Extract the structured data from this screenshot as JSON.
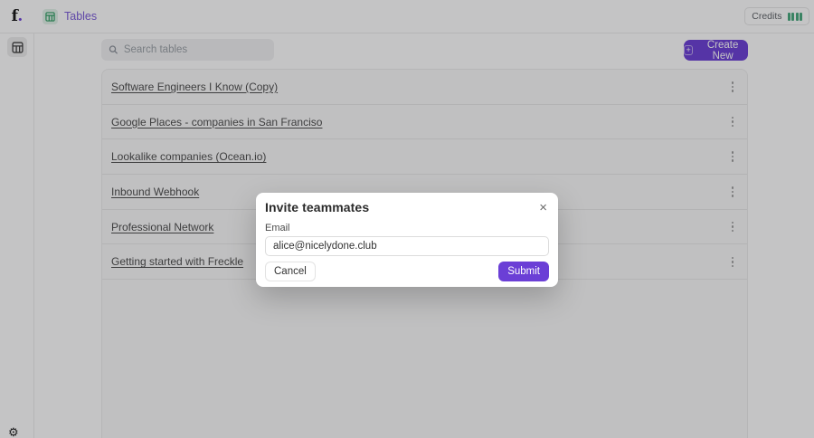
{
  "topbar": {
    "logo": {
      "f": "f",
      "dot": "."
    },
    "breadcrumb_label": "Tables",
    "credits": {
      "label": "Credits",
      "bars": 4
    }
  },
  "toolbar": {
    "search_placeholder": "Search tables",
    "create_plus": "+",
    "create_label": "Create New"
  },
  "tables": [
    {
      "title": "Software Engineers I Know (Copy)"
    },
    {
      "title": "Google Places - companies in San Franciso"
    },
    {
      "title": "Lookalike companies (Ocean.io)"
    },
    {
      "title": "Inbound Webhook"
    },
    {
      "title": "Professional Network"
    },
    {
      "title": "Getting started with Freckle"
    }
  ],
  "modal": {
    "title": "Invite teammates",
    "email_label": "Email",
    "email_value": "alice@nicelydone.club",
    "cancel_label": "Cancel",
    "submit_label": "Submit"
  },
  "icons": {
    "close": "×",
    "gear": "⚙"
  },
  "colors": {
    "accent_purple": "#6b3fd6",
    "brand_green": "#2f9e63",
    "credit_bar_green": "#47a87c"
  }
}
